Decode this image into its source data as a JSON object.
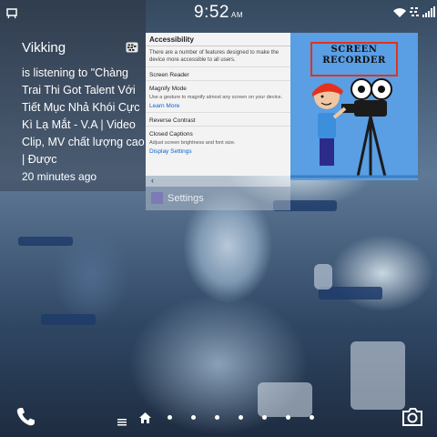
{
  "status_bar": {
    "time": "9:52",
    "ampm": "AM"
  },
  "hub_notification": {
    "contact_name": "Vikking",
    "message": "is listening to \"Chàng Trai Thi Got Talent Với Tiết Mục Nhả Khói Cực Kì Lạ Mắt - V.A | Video Clip, MV chất lượng cao | Được",
    "time_ago": "20 minutes ago"
  },
  "settings_card": {
    "title": "Accessibility",
    "intro": "There are a number of features designed to make the device more accessible to all users.",
    "items": [
      {
        "label": "Screen Reader",
        "desc": "",
        "link": ""
      },
      {
        "label": "Magnify Mode",
        "desc": "Use a gesture to magnify almost any screen on your device.",
        "link": "Learn More"
      },
      {
        "label": "Reverse Contrast",
        "desc": "",
        "link": ""
      },
      {
        "label": "Closed Captions",
        "desc": "Adjust screen brightness and font size.",
        "link": "Display Settings"
      }
    ],
    "footer_back": "‹",
    "app_label": "Settings"
  },
  "recorder_card": {
    "title_line1": "SCREEN",
    "title_line2": "RECORDER"
  },
  "dock": {
    "phone_icon": "phone-icon",
    "hub_icon": "hub-icon",
    "home_icon": "home-icon",
    "page_dots": 8,
    "camera_icon": "camera-icon"
  },
  "colors": {
    "recorder_bg": "#5a9ee4",
    "recorder_frame": "#e2321e",
    "settings_link": "#0a64c8"
  }
}
